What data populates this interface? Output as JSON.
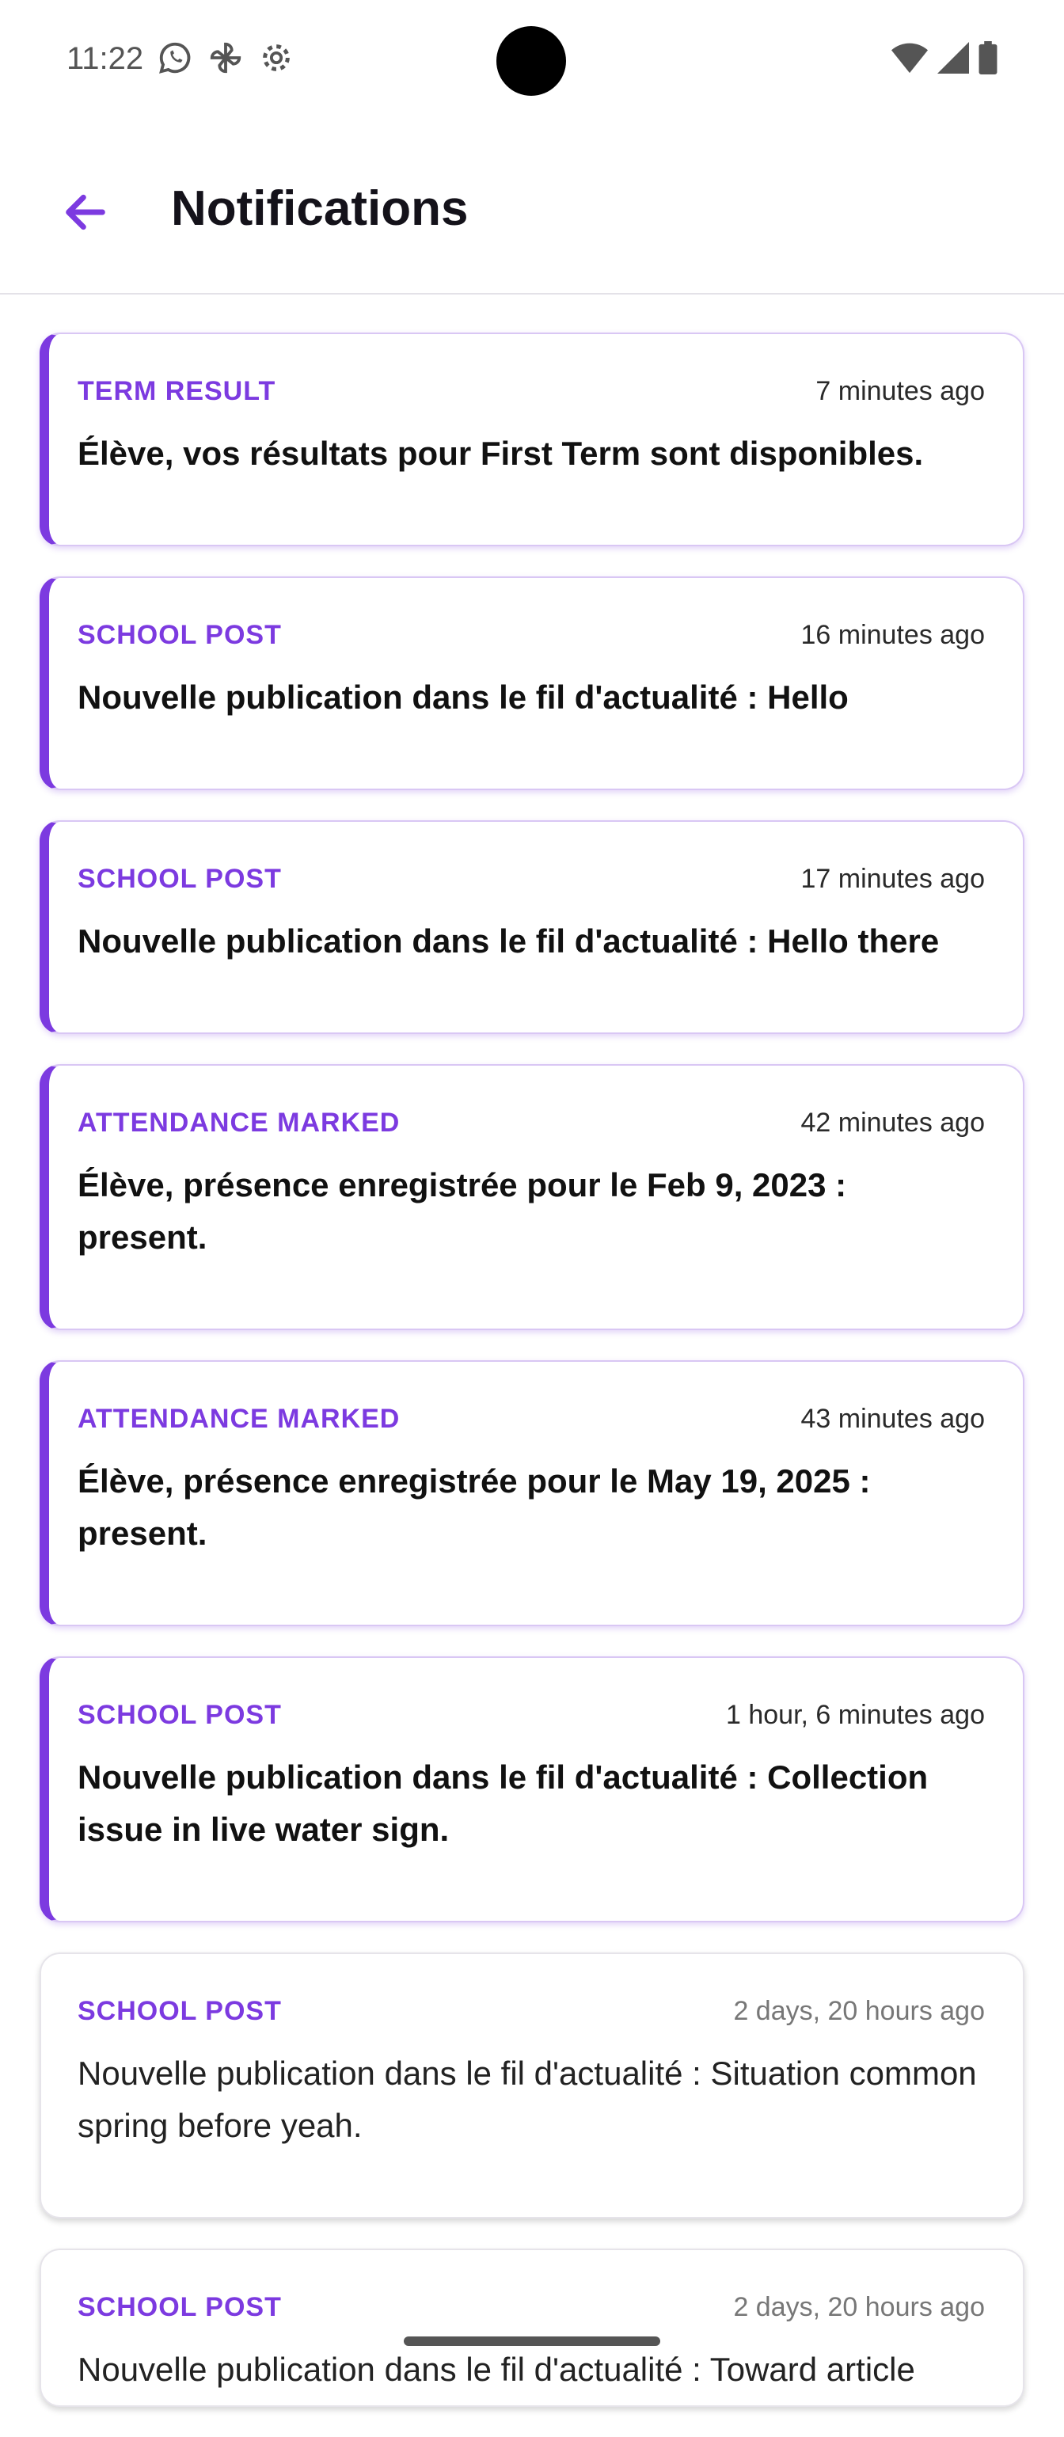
{
  "status_bar": {
    "time": "11:22",
    "left_icons": [
      "whatsapp-icon",
      "pinwheel-icon",
      "settings-icon"
    ],
    "right_icons": [
      "wifi-icon",
      "signal-icon",
      "battery-icon"
    ]
  },
  "header": {
    "back_icon": "arrow-back-icon",
    "title": "Notifications"
  },
  "colors": {
    "accent": "#7c3ae0",
    "card_border": "#d9c7f4",
    "read_border": "#e6e4ea"
  },
  "notifications": [
    {
      "type": "TERM RESULT",
      "time": "7 minutes ago",
      "message": "Élève, vos résultats pour First Term sont disponibles.",
      "unread": true
    },
    {
      "type": "SCHOOL POST",
      "time": "16 minutes ago",
      "message": "Nouvelle publication dans le fil d'actualité : Hello",
      "unread": true
    },
    {
      "type": "SCHOOL POST",
      "time": "17 minutes ago",
      "message": "Nouvelle publication dans le fil d'actualité : Hello there",
      "unread": true
    },
    {
      "type": "ATTENDANCE MARKED",
      "time": "42 minutes ago",
      "message": "Élève, présence enregistrée pour le Feb 9, 2023 : present.",
      "unread": true
    },
    {
      "type": "ATTENDANCE MARKED",
      "time": "43 minutes ago",
      "message": "Élève, présence enregistrée pour le May 19, 2025 : present.",
      "unread": true
    },
    {
      "type": "SCHOOL POST",
      "time": "1 hour, 6 minutes ago",
      "message": "Nouvelle publication dans le fil d'actualité : Collection issue in live water sign.",
      "unread": true
    },
    {
      "type": "SCHOOL POST",
      "time": "2 days, 20 hours ago",
      "message": "Nouvelle publication dans le fil d'actualité : Situation common spring before yeah.",
      "unread": false
    },
    {
      "type": "SCHOOL POST",
      "time": "2 days, 20 hours ago",
      "message": "Nouvelle publication dans le fil d'actualité : Toward article",
      "unread": false
    }
  ]
}
